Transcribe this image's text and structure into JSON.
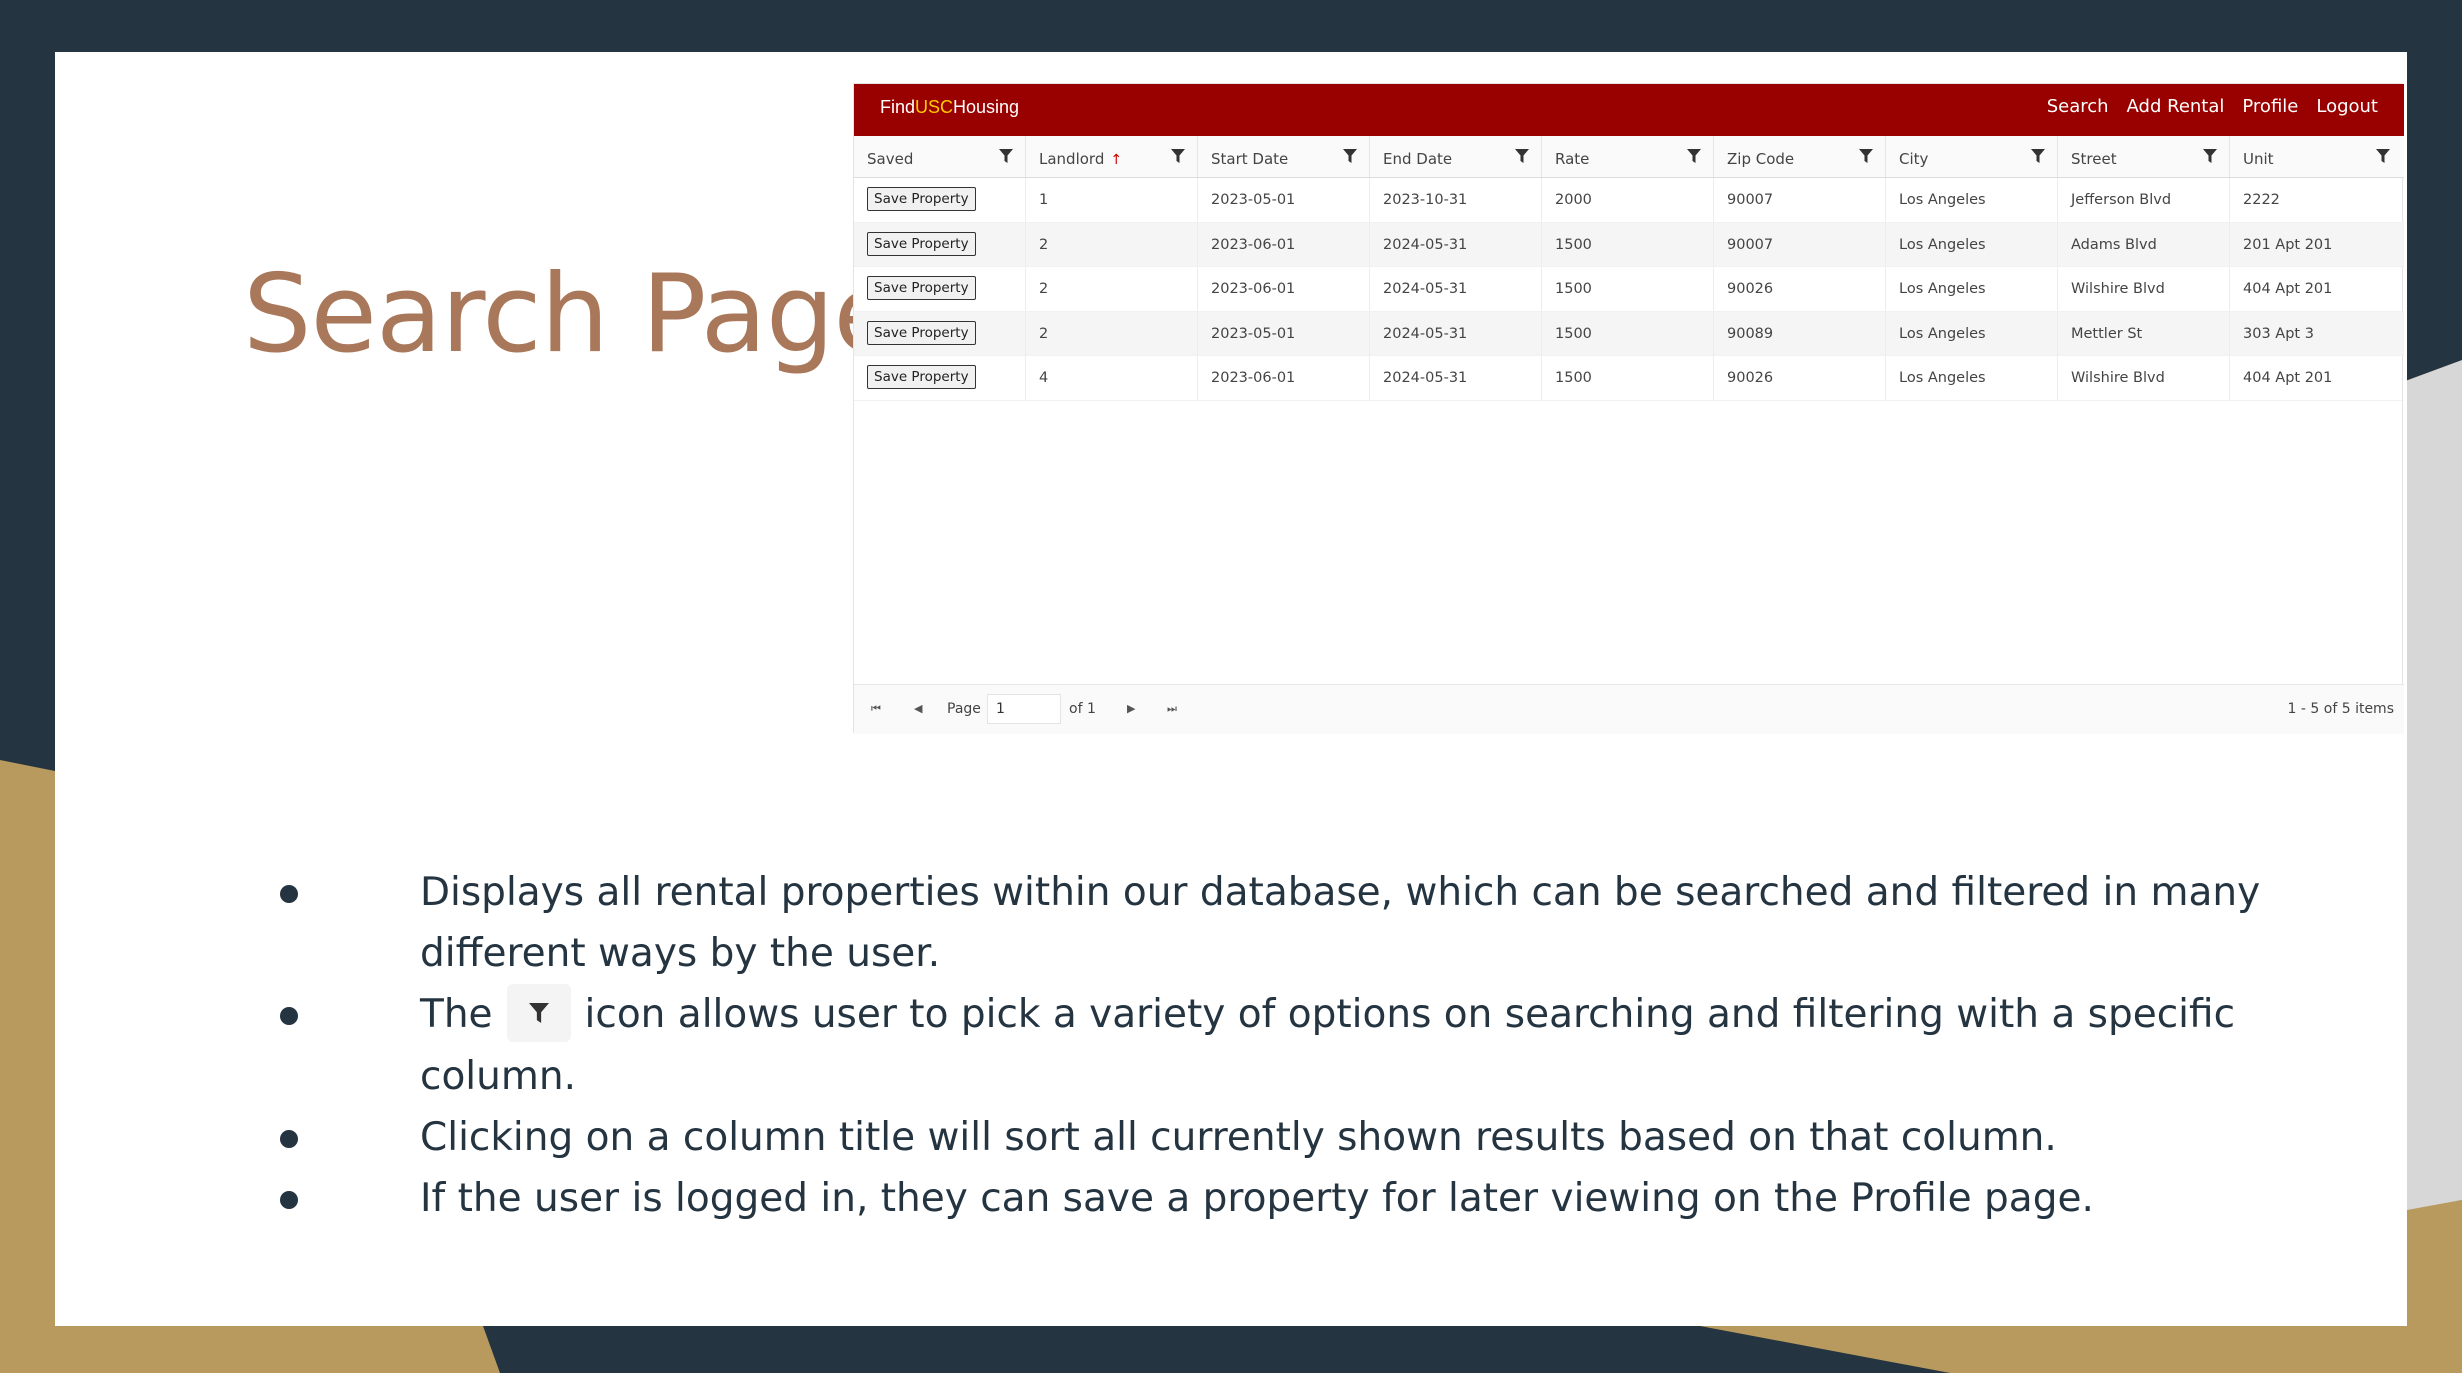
{
  "slide": {
    "title": "Search Page"
  },
  "app": {
    "brand": {
      "part1": "Find",
      "part2": "USC",
      "part3": "Housing"
    },
    "nav": [
      "Search",
      "Add Rental",
      "Profile",
      "Logout"
    ],
    "columns": [
      "Saved",
      "Landlord",
      "Start Date",
      "End Date",
      "Rate",
      "Zip Code",
      "City",
      "Street",
      "Unit"
    ],
    "sorted_column": "Landlord",
    "sort_direction": "ascending",
    "save_label": "Save Property",
    "rows": [
      {
        "landlord": "1",
        "start": "2023-05-01",
        "end": "2023-10-31",
        "rate": "2000",
        "zip": "90007",
        "city": "Los Angeles",
        "street": "Jefferson Blvd",
        "unit": "2222"
      },
      {
        "landlord": "2",
        "start": "2023-06-01",
        "end": "2024-05-31",
        "rate": "1500",
        "zip": "90007",
        "city": "Los Angeles",
        "street": "Adams Blvd",
        "unit": "201 Apt 201"
      },
      {
        "landlord": "2",
        "start": "2023-06-01",
        "end": "2024-05-31",
        "rate": "1500",
        "zip": "90026",
        "city": "Los Angeles",
        "street": "Wilshire Blvd",
        "unit": "404 Apt 201"
      },
      {
        "landlord": "2",
        "start": "2023-05-01",
        "end": "2024-05-31",
        "rate": "1500",
        "zip": "90089",
        "city": "Los Angeles",
        "street": "Mettler St",
        "unit": "303 Apt 3"
      },
      {
        "landlord": "4",
        "start": "2023-06-01",
        "end": "2024-05-31",
        "rate": "1500",
        "zip": "90026",
        "city": "Los Angeles",
        "street": "Wilshire Blvd",
        "unit": "404 Apt 201"
      }
    ],
    "pager": {
      "page_label": "Page",
      "page_value": "1",
      "of_label": "of 1",
      "items_label": "1 - 5 of 5 items"
    }
  },
  "bullets": {
    "b1_line1": "Displays all rental properties within our database, which can be searched and filtered in many",
    "b1_line2": "different ways by the user.",
    "b2_before": "The",
    "b2_after": "icon allows user to pick a variety of options on searching and filtering with a specific column.",
    "b3": "Clicking on a column title will sort all currently shown results based on that column.",
    "b4": "If the user is logged in, they can save a property for later viewing on the Profile page."
  },
  "colors": {
    "navbar": "#990000",
    "brand_accent": "#ffcc00",
    "title": "#a9785a",
    "dark": "#253441",
    "gold": "#b89a5e"
  }
}
